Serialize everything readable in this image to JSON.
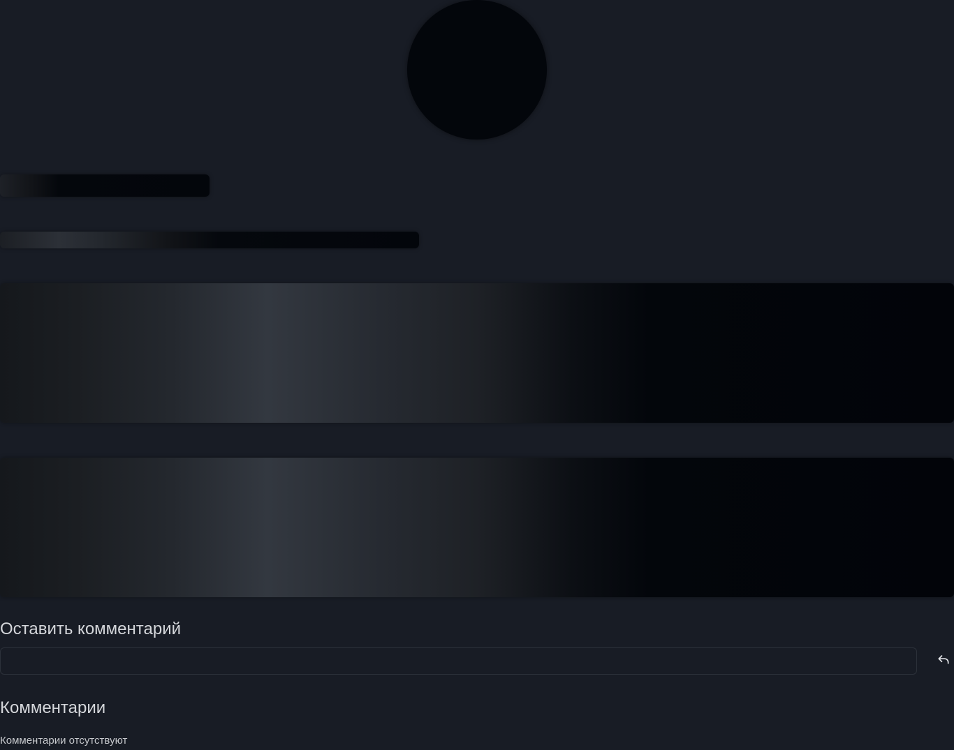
{
  "loading_placeholders": {
    "avatar": "avatar-skeleton",
    "title": "title-skeleton",
    "subtitle": "subtitle-skeleton",
    "blocks": [
      "content-block-skeleton",
      "content-block-skeleton"
    ]
  },
  "comment_form": {
    "heading": "Оставить комментарий",
    "input_value": "",
    "input_placeholder": "",
    "submit_icon": "reply-icon"
  },
  "comments": {
    "heading": "Комментарии",
    "empty_text": "Комментарии отсутствуют"
  },
  "colors": {
    "background": "#181c25",
    "skeleton_dark": "#03060b",
    "skeleton_highlight": "#333840",
    "text": "#d4d6da",
    "input_border": "#2c313a"
  }
}
